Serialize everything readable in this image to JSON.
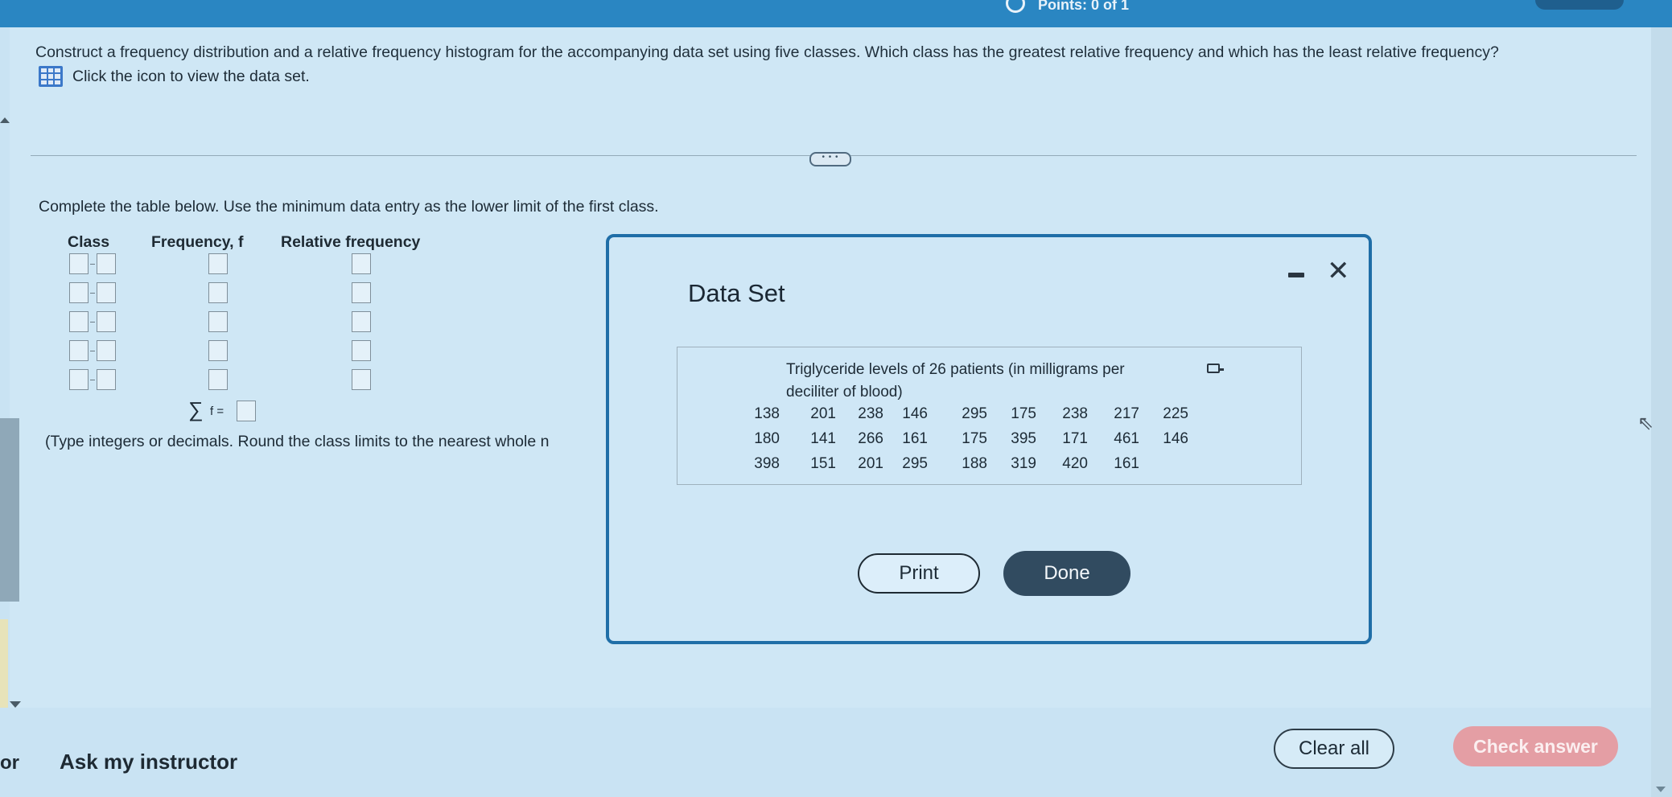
{
  "header": {
    "title_fragment": "Points: 0 of 1"
  },
  "question": {
    "text": "Construct a frequency distribution and a relative frequency histogram for the accompanying data set using five classes. Which class has the greatest relative frequency and which has the least relative frequency?",
    "dataset_link": "Click the icon to view the data set."
  },
  "expander": {
    "label": "• • •"
  },
  "work": {
    "instruction": "Complete the table below. Use the minimum data entry as the lower limit of the first class.",
    "headers": {
      "class": "Class",
      "frequency": "Frequency, f",
      "relative": "Relative frequency"
    },
    "sum_label": "f =",
    "note": "(Type integers or decimals. Round the class limits to the nearest whole n"
  },
  "modal": {
    "title": "Data Set",
    "caption": "Triglyceride levels of 26 patients (in milligrams per deciliter of blood)",
    "rows": [
      [
        "138",
        "201",
        "238",
        "146",
        "295",
        "175",
        "238",
        "217",
        "225"
      ],
      [
        "180",
        "141",
        "266",
        "161",
        "175",
        "395",
        "171",
        "461",
        "146"
      ],
      [
        "398",
        "151",
        "201",
        "295",
        "188",
        "319",
        "420",
        "161",
        ""
      ]
    ],
    "print_label": "Print",
    "done_label": "Done"
  },
  "footer": {
    "left_partial": "or",
    "ask_label": "Ask my instructor",
    "clear_label": "Clear all",
    "check_label": "Check answer"
  }
}
